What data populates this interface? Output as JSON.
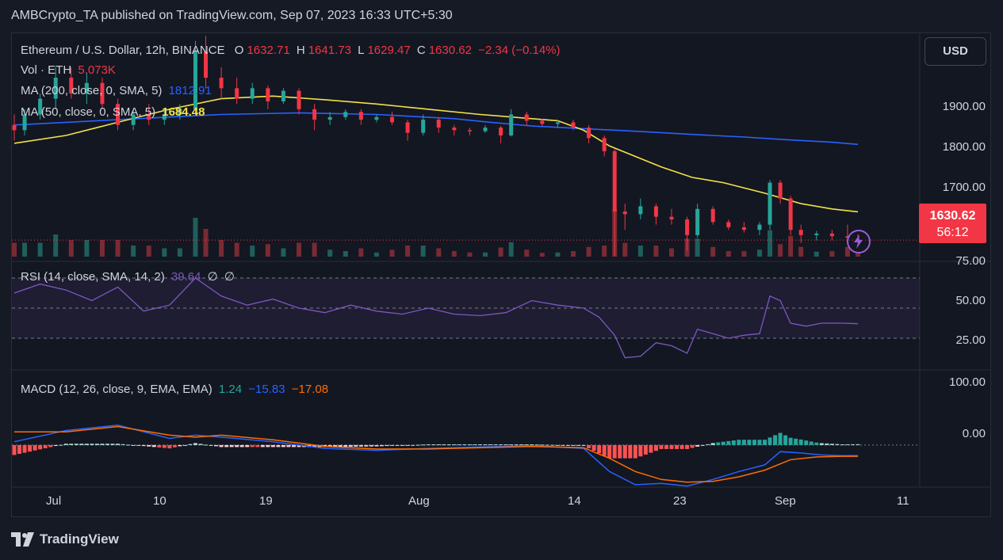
{
  "header": {
    "text": "AMBCrypto_TA published on TradingView.com, Sep 07, 2023 16:33 UTC+5:30"
  },
  "legend": {
    "symbol": "Ethereum / U.S. Dollar, 12h, BINANCE",
    "o_label": "O",
    "o": "1632.71",
    "h_label": "H",
    "h": "1641.73",
    "l_label": "L",
    "l": "1629.47",
    "c_label": "C",
    "c": "1630.62",
    "change": "−2.34 (−0.14%)",
    "vol_label": "Vol · ETH",
    "vol": "5.073K",
    "ma200_label": "MA (200, close, 0, SMA, 5)",
    "ma200": "1812.91",
    "ma50_label": "MA (50, close, 0, SMA, 5)",
    "ma50": "1684.48",
    "rsi_label": "RSI (14, close, SMA, 14, 2)",
    "rsi": "39.64",
    "rsi_e1": "∅",
    "rsi_e2": "∅",
    "macd_label": "MACD (12, 26, close, 9, EMA, EMA)",
    "macd_hist": "1.24",
    "macd": "−15.83",
    "macd_signal": "−17.08"
  },
  "currency_button": "USD",
  "price_tag": {
    "price": "1630.62",
    "countdown": "56:12"
  },
  "price_axis": [
    "1900.00",
    "1800.00",
    "1700.00"
  ],
  "rsi_axis": [
    "75.00",
    "50.00",
    "25.00"
  ],
  "macd_axis": [
    "100.00",
    "0.00"
  ],
  "time_axis": [
    "Jul",
    "10",
    "19",
    "Aug",
    "14",
    "23",
    "Sep",
    "11"
  ],
  "footer": {
    "brand": "TradingView"
  },
  "colors": {
    "up": "#26a69a",
    "down": "#f23645",
    "ma50": "#f5e14a",
    "ma200": "#2962ff",
    "rsi": "#7e57c2",
    "macd": "#2962ff",
    "signal": "#ff6d00"
  },
  "chart_data": {
    "type": "candlestick",
    "title": "Ethereum / U.S. Dollar, 12h, BINANCE",
    "x_ticks": [
      "Jul",
      "10",
      "19",
      "Aug",
      "14",
      "23",
      "Sep",
      "11"
    ],
    "ylim": [
      1590,
      1990
    ],
    "series": [
      {
        "name": "MA (200, close, 0, SMA, 5)",
        "points": [
          [
            0,
            1850
          ],
          [
            20,
            1860
          ],
          [
            40,
            1870
          ],
          [
            55,
            1873
          ],
          [
            70,
            1870
          ],
          [
            85,
            1862
          ],
          [
            92,
            1855
          ],
          [
            100,
            1848
          ],
          [
            110,
            1843
          ],
          [
            120,
            1838
          ],
          [
            131,
            1832
          ],
          [
            141,
            1827
          ],
          [
            149,
            1822
          ],
          [
            158,
            1817
          ],
          [
            163,
            1813
          ]
        ]
      },
      {
        "name": "MA (50, close, 0, SMA, 5)",
        "points": [
          [
            0,
            1815
          ],
          [
            10,
            1830
          ],
          [
            20,
            1855
          ],
          [
            30,
            1880
          ],
          [
            40,
            1900
          ],
          [
            50,
            1905
          ],
          [
            60,
            1898
          ],
          [
            70,
            1890
          ],
          [
            80,
            1880
          ],
          [
            90,
            1870
          ],
          [
            100,
            1862
          ],
          [
            105,
            1858
          ],
          [
            110,
            1840
          ],
          [
            115,
            1810
          ],
          [
            120,
            1790
          ],
          [
            125,
            1770
          ],
          [
            131,
            1750
          ],
          [
            137,
            1740
          ],
          [
            145,
            1720
          ],
          [
            152,
            1700
          ],
          [
            158,
            1690
          ],
          [
            163,
            1684.48
          ]
        ]
      }
    ],
    "candles": [
      {
        "i": 0,
        "o": 1850,
        "h": 1870,
        "l": 1820,
        "c": 1840
      },
      {
        "i": 2,
        "o": 1840,
        "h": 1880,
        "l": 1830,
        "c": 1870
      },
      {
        "i": 5,
        "o": 1870,
        "h": 1910,
        "l": 1860,
        "c": 1900
      },
      {
        "i": 8,
        "o": 1900,
        "h": 1960,
        "l": 1880,
        "c": 1940
      },
      {
        "i": 11,
        "o": 1940,
        "h": 1960,
        "l": 1900,
        "c": 1910
      },
      {
        "i": 14,
        "o": 1910,
        "h": 1950,
        "l": 1890,
        "c": 1930
      },
      {
        "i": 17,
        "o": 1930,
        "h": 1940,
        "l": 1880,
        "c": 1890
      },
      {
        "i": 20,
        "o": 1890,
        "h": 1900,
        "l": 1840,
        "c": 1850
      },
      {
        "i": 23,
        "o": 1850,
        "h": 1880,
        "l": 1840,
        "c": 1870
      },
      {
        "i": 26,
        "o": 1870,
        "h": 1890,
        "l": 1850,
        "c": 1860
      },
      {
        "i": 29,
        "o": 1860,
        "h": 1880,
        "l": 1850,
        "c": 1870
      },
      {
        "i": 32,
        "o": 1870,
        "h": 1890,
        "l": 1860,
        "c": 1880
      },
      {
        "i": 35,
        "o": 1880,
        "h": 2010,
        "l": 1870,
        "c": 1990
      },
      {
        "i": 37,
        "o": 1990,
        "h": 2020,
        "l": 1920,
        "c": 1940
      },
      {
        "i": 40,
        "o": 1940,
        "h": 1960,
        "l": 1900,
        "c": 1920
      },
      {
        "i": 43,
        "o": 1920,
        "h": 1940,
        "l": 1890,
        "c": 1900
      },
      {
        "i": 46,
        "o": 1900,
        "h": 1930,
        "l": 1890,
        "c": 1920
      },
      {
        "i": 49,
        "o": 1920,
        "h": 1925,
        "l": 1880,
        "c": 1895
      },
      {
        "i": 52,
        "o": 1895,
        "h": 1920,
        "l": 1890,
        "c": 1915
      },
      {
        "i": 55,
        "o": 1915,
        "h": 1920,
        "l": 1870,
        "c": 1880
      },
      {
        "i": 58,
        "o": 1880,
        "h": 1890,
        "l": 1840,
        "c": 1860
      },
      {
        "i": 61,
        "o": 1860,
        "h": 1875,
        "l": 1850,
        "c": 1865
      },
      {
        "i": 64,
        "o": 1865,
        "h": 1880,
        "l": 1860,
        "c": 1875
      },
      {
        "i": 67,
        "o": 1875,
        "h": 1880,
        "l": 1850,
        "c": 1860
      },
      {
        "i": 70,
        "o": 1860,
        "h": 1870,
        "l": 1855,
        "c": 1865
      },
      {
        "i": 73,
        "o": 1865,
        "h": 1875,
        "l": 1850,
        "c": 1855
      },
      {
        "i": 76,
        "o": 1855,
        "h": 1860,
        "l": 1820,
        "c": 1835
      },
      {
        "i": 79,
        "o": 1835,
        "h": 1870,
        "l": 1830,
        "c": 1860
      },
      {
        "i": 82,
        "o": 1860,
        "h": 1865,
        "l": 1835,
        "c": 1845
      },
      {
        "i": 85,
        "o": 1845,
        "h": 1850,
        "l": 1830,
        "c": 1840
      },
      {
        "i": 88,
        "o": 1840,
        "h": 1845,
        "l": 1830,
        "c": 1838
      },
      {
        "i": 91,
        "o": 1838,
        "h": 1850,
        "l": 1835,
        "c": 1845
      },
      {
        "i": 94,
        "o": 1845,
        "h": 1848,
        "l": 1815,
        "c": 1830
      },
      {
        "i": 96,
        "o": 1830,
        "h": 1880,
        "l": 1828,
        "c": 1870
      },
      {
        "i": 99,
        "o": 1870,
        "h": 1875,
        "l": 1850,
        "c": 1858
      },
      {
        "i": 102,
        "o": 1858,
        "h": 1862,
        "l": 1848,
        "c": 1852
      },
      {
        "i": 105,
        "o": 1852,
        "h": 1860,
        "l": 1845,
        "c": 1855
      },
      {
        "i": 108,
        "o": 1855,
        "h": 1860,
        "l": 1840,
        "c": 1845
      },
      {
        "i": 111,
        "o": 1845,
        "h": 1850,
        "l": 1815,
        "c": 1825
      },
      {
        "i": 114,
        "o": 1825,
        "h": 1830,
        "l": 1790,
        "c": 1800
      },
      {
        "i": 116,
        "o": 1800,
        "h": 1805,
        "l": 1600,
        "c": 1685
      },
      {
        "i": 118,
        "o": 1685,
        "h": 1700,
        "l": 1650,
        "c": 1680
      },
      {
        "i": 121,
        "o": 1680,
        "h": 1710,
        "l": 1670,
        "c": 1695
      },
      {
        "i": 124,
        "o": 1695,
        "h": 1700,
        "l": 1660,
        "c": 1675
      },
      {
        "i": 127,
        "o": 1675,
        "h": 1690,
        "l": 1660,
        "c": 1670
      },
      {
        "i": 130,
        "o": 1670,
        "h": 1675,
        "l": 1610,
        "c": 1640
      },
      {
        "i": 132,
        "o": 1640,
        "h": 1700,
        "l": 1635,
        "c": 1690
      },
      {
        "i": 135,
        "o": 1690,
        "h": 1695,
        "l": 1660,
        "c": 1665
      },
      {
        "i": 138,
        "o": 1665,
        "h": 1670,
        "l": 1650,
        "c": 1655
      },
      {
        "i": 141,
        "o": 1655,
        "h": 1665,
        "l": 1645,
        "c": 1650
      },
      {
        "i": 144,
        "o": 1650,
        "h": 1665,
        "l": 1640,
        "c": 1660
      },
      {
        "i": 146,
        "o": 1660,
        "h": 1745,
        "l": 1650,
        "c": 1740
      },
      {
        "i": 148,
        "o": 1740,
        "h": 1745,
        "l": 1700,
        "c": 1710
      },
      {
        "i": 150,
        "o": 1710,
        "h": 1715,
        "l": 1640,
        "c": 1650
      },
      {
        "i": 152,
        "o": 1650,
        "h": 1660,
        "l": 1625,
        "c": 1640
      },
      {
        "i": 155,
        "o": 1640,
        "h": 1648,
        "l": 1630,
        "c": 1643
      },
      {
        "i": 158,
        "o": 1643,
        "h": 1650,
        "l": 1630,
        "c": 1638
      },
      {
        "i": 161,
        "o": 1638,
        "h": 1660,
        "l": 1625,
        "c": 1635
      },
      {
        "i": 163,
        "o": 1632.71,
        "h": 1641.73,
        "l": 1629.47,
        "c": 1630.62
      }
    ],
    "rsi": {
      "name": "RSI (14, close, SMA, 14, 2)",
      "ylim": [
        10,
        80
      ],
      "points": [
        [
          0,
          60
        ],
        [
          5,
          66
        ],
        [
          10,
          62
        ],
        [
          15,
          55
        ],
        [
          20,
          64
        ],
        [
          25,
          48
        ],
        [
          30,
          52
        ],
        [
          35,
          70
        ],
        [
          40,
          58
        ],
        [
          45,
          52
        ],
        [
          50,
          56
        ],
        [
          55,
          50
        ],
        [
          60,
          47
        ],
        [
          65,
          52
        ],
        [
          70,
          48
        ],
        [
          75,
          46
        ],
        [
          80,
          50
        ],
        [
          85,
          46
        ],
        [
          90,
          45
        ],
        [
          95,
          47
        ],
        [
          100,
          55
        ],
        [
          105,
          52
        ],
        [
          110,
          50
        ],
        [
          113,
          44
        ],
        [
          116,
          32
        ],
        [
          118,
          17
        ],
        [
          121,
          18
        ],
        [
          124,
          27
        ],
        [
          127,
          25
        ],
        [
          130,
          20
        ],
        [
          132,
          36
        ],
        [
          135,
          33
        ],
        [
          138,
          30
        ],
        [
          141,
          32
        ],
        [
          144,
          33
        ],
        [
          146,
          58
        ],
        [
          148,
          55
        ],
        [
          150,
          40
        ],
        [
          153,
          38
        ],
        [
          156,
          40
        ],
        [
          160,
          40
        ],
        [
          163,
          39.64
        ]
      ]
    },
    "macd": {
      "name": "MACD (12, 26, close, 9, EMA, EMA)",
      "ylim": [
        -60,
        110
      ],
      "macd_points": [
        [
          0,
          5
        ],
        [
          10,
          22
        ],
        [
          20,
          30
        ],
        [
          30,
          10
        ],
        [
          35,
          15
        ],
        [
          40,
          12
        ],
        [
          50,
          5
        ],
        [
          60,
          -5
        ],
        [
          70,
          -8
        ],
        [
          80,
          -5
        ],
        [
          90,
          -3
        ],
        [
          100,
          -1
        ],
        [
          110,
          -5
        ],
        [
          115,
          -40
        ],
        [
          120,
          -60
        ],
        [
          125,
          -58
        ],
        [
          130,
          -62
        ],
        [
          135,
          -52
        ],
        [
          140,
          -40
        ],
        [
          145,
          -30
        ],
        [
          148,
          -10
        ],
        [
          152,
          -12
        ],
        [
          156,
          -15
        ],
        [
          160,
          -16
        ],
        [
          163,
          -15.83
        ]
      ],
      "signal_points": [
        [
          0,
          20
        ],
        [
          10,
          20
        ],
        [
          20,
          28
        ],
        [
          30,
          15
        ],
        [
          35,
          12
        ],
        [
          40,
          15
        ],
        [
          50,
          8
        ],
        [
          60,
          -2
        ],
        [
          70,
          -6
        ],
        [
          80,
          -6
        ],
        [
          90,
          -4
        ],
        [
          100,
          -2
        ],
        [
          110,
          -4
        ],
        [
          115,
          -20
        ],
        [
          120,
          -40
        ],
        [
          125,
          -52
        ],
        [
          130,
          -56
        ],
        [
          135,
          -55
        ],
        [
          140,
          -48
        ],
        [
          145,
          -38
        ],
        [
          150,
          -22
        ],
        [
          155,
          -18
        ],
        [
          160,
          -17
        ],
        [
          163,
          -17.08
        ]
      ]
    },
    "volume": {
      "name": "Vol · ETH",
      "last": "5.073K"
    }
  }
}
